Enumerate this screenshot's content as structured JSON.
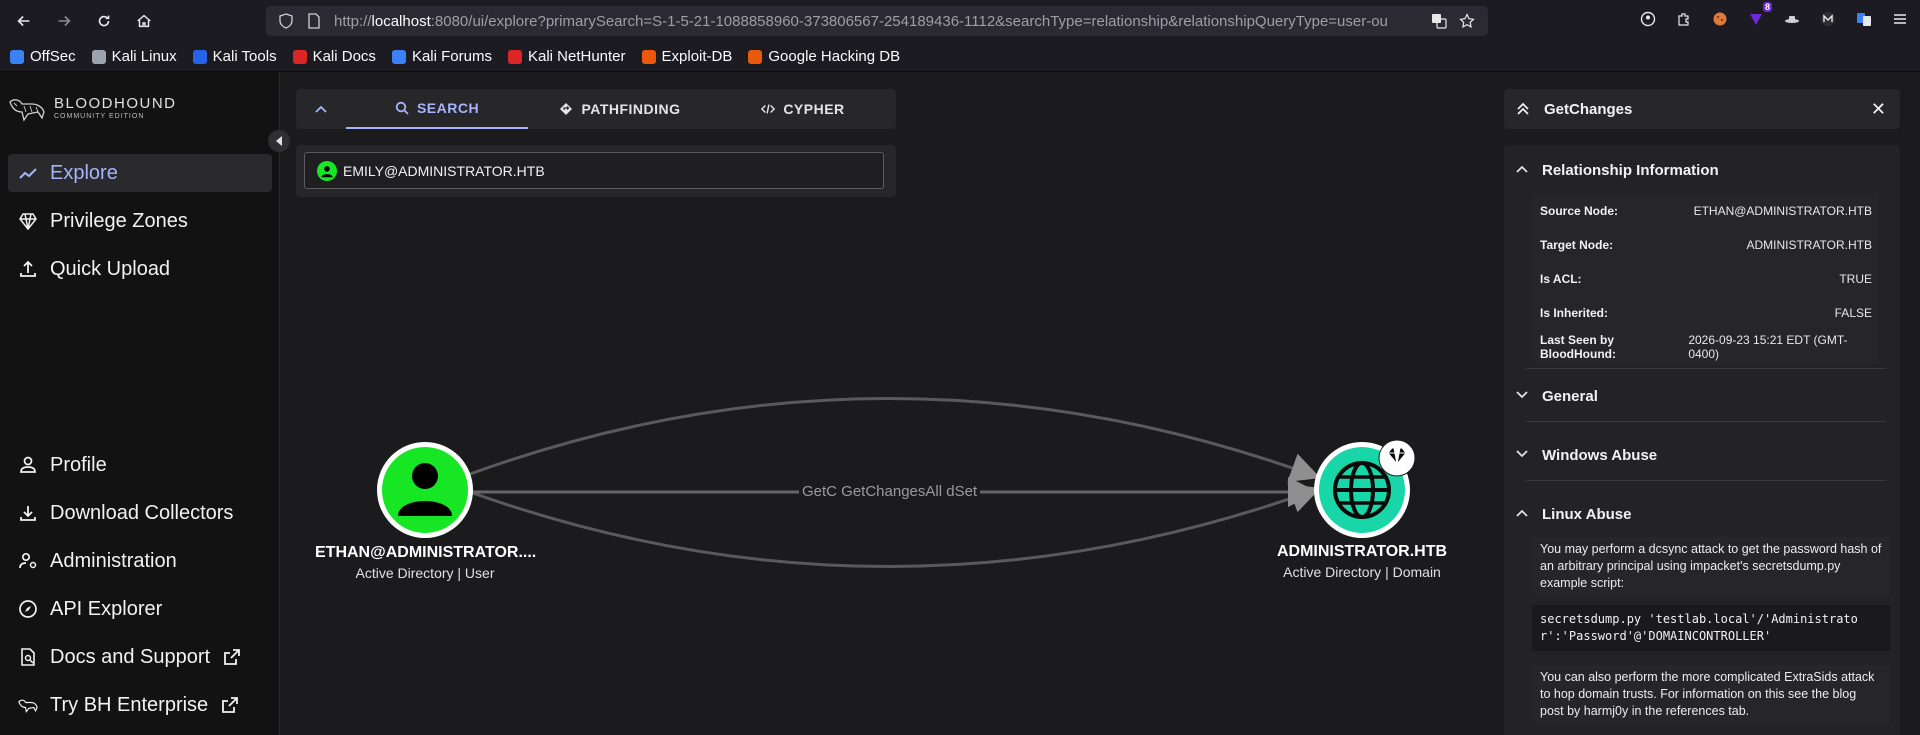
{
  "browser": {
    "url_scheme": "http://",
    "url_host": "localhost",
    "url_rest": ":8080/ui/explore?primarySearch=S-1-5-21-1088858960-373806567-254189436-1112&searchType=relationship&relationshipQueryType=user-ou",
    "extension_badge": "8"
  },
  "bookmarks": [
    {
      "label": "OffSec",
      "color": "#3b82f6"
    },
    {
      "label": "Kali Linux",
      "color": "#9ca3af"
    },
    {
      "label": "Kali Tools",
      "color": "#2563eb"
    },
    {
      "label": "Kali Docs",
      "color": "#dc2626"
    },
    {
      "label": "Kali Forums",
      "color": "#3b82f6"
    },
    {
      "label": "Kali NetHunter",
      "color": "#dc2626"
    },
    {
      "label": "Exploit-DB",
      "color": "#ea580c"
    },
    {
      "label": "Google Hacking DB",
      "color": "#ea580c"
    }
  ],
  "sidebar": {
    "brand": "BLOODHOUND",
    "edition": "COMMUNITY EDITION",
    "top_items": [
      {
        "label": "Explore",
        "icon": "trending-icon",
        "active": true
      },
      {
        "label": "Privilege Zones",
        "icon": "gem-icon"
      },
      {
        "label": "Quick Upload",
        "icon": "upload-icon"
      }
    ],
    "bottom_items": [
      {
        "label": "Profile",
        "icon": "person-icon"
      },
      {
        "label": "Download Collectors",
        "icon": "download-icon"
      },
      {
        "label": "Administration",
        "icon": "admin-icon"
      },
      {
        "label": "API Explorer",
        "icon": "compass-icon"
      },
      {
        "label": "Docs and Support",
        "icon": "docs-icon",
        "external": true
      },
      {
        "label": "Try BH Enterprise",
        "icon": "dog-icon",
        "external": true
      }
    ]
  },
  "search": {
    "tabs": [
      "SEARCH",
      "PATHFINDING",
      "CYPHER"
    ],
    "active_tab": "SEARCH",
    "value": "EMILY@ADMINISTRATOR.HTB"
  },
  "graph": {
    "source": {
      "name": "ETHAN@ADMINISTRATOR....",
      "kind": "Active Directory | User",
      "color": "#17e625"
    },
    "target": {
      "name": "ADMINISTRATOR.HTB",
      "kind": "Active Directory | Domain",
      "color": "#19d6a8"
    },
    "edge_label": "GetC GetChangesAll dSet"
  },
  "panel": {
    "title": "GetChanges",
    "sections": {
      "relationship": "Relationship Information",
      "general": "General",
      "windows": "Windows Abuse",
      "linux": "Linux Abuse"
    },
    "props": [
      {
        "k": "Source Node:",
        "v": "ETHAN@ADMINISTRATOR.HTB"
      },
      {
        "k": "Target Node:",
        "v": "ADMINISTRATOR.HTB"
      },
      {
        "k": "Is ACL:",
        "v": "TRUE"
      },
      {
        "k": "Is Inherited:",
        "v": "FALSE"
      },
      {
        "k": "Last Seen by BloodHound:",
        "v": "2026-09-23 15:21 EDT (GMT-0400)"
      }
    ],
    "linux_text_1": "You may perform a dcsync attack to get the password hash of an arbitrary principal using impacket's secretsdump.py example script:",
    "linux_code": "secretsdump.py 'testlab.local'/'Administrator':'Password'@'DOMAINCONTROLLER'",
    "linux_text_2": "You can also perform the more complicated ExtraSids attack to hop domain trusts. For information on this see the blog post by harmj0y in the references tab."
  }
}
